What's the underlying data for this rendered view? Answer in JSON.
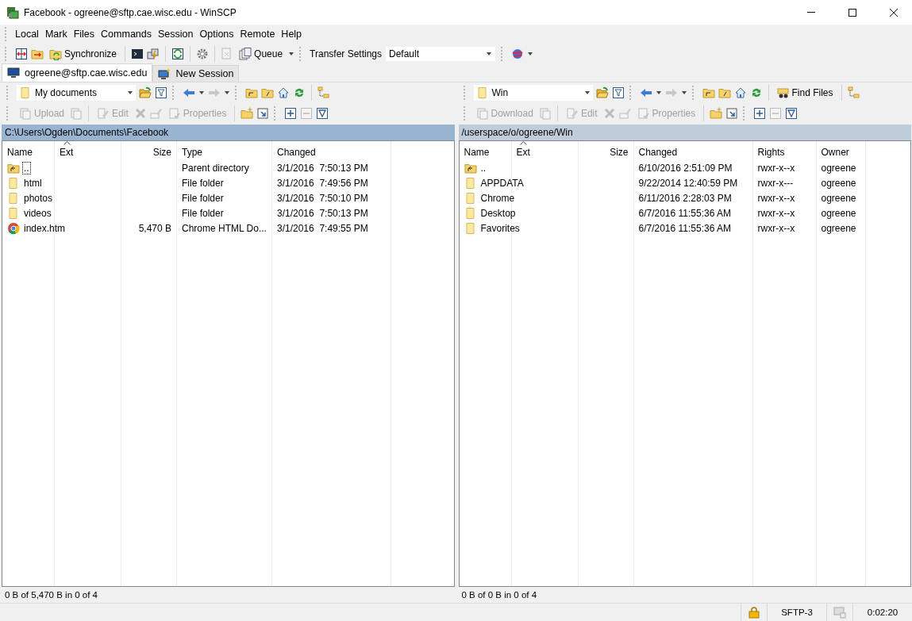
{
  "window": {
    "title": "Facebook - ogreene@sftp.cae.wisc.edu - WinSCP"
  },
  "menu": [
    "Local",
    "Mark",
    "Files",
    "Commands",
    "Session",
    "Options",
    "Remote",
    "Help"
  ],
  "toolbar": {
    "synchronize": "Synchronize",
    "queue": "Queue",
    "transfer_settings_label": "Transfer Settings",
    "transfer_settings_value": "Default"
  },
  "session_tabs": [
    {
      "label": "ogreene@sftp.cae.wisc.edu",
      "selected": true
    },
    {
      "label": "New Session",
      "selected": false
    }
  ],
  "panels": [
    {
      "location": "My documents",
      "active": true,
      "actions": [
        {
          "label": "Upload",
          "disabled": true
        },
        {
          "label": "Edit",
          "disabled": true
        },
        {
          "label": "Properties",
          "disabled": true
        }
      ],
      "path": "C:\\Users\\Ogden\\Documents\\Facebook",
      "columns": [
        {
          "label": "Name",
          "sorted": false
        },
        {
          "label": "Ext",
          "sorted": true
        },
        {
          "label": "Size",
          "sorted": false
        },
        {
          "label": "Type",
          "sorted": false
        },
        {
          "label": "Changed",
          "sorted": false
        }
      ],
      "rows": [
        {
          "kind": "parent",
          "focused": true,
          "cells": [
            "..",
            null,
            null,
            "Parent directory",
            "3/1/2016  7:50:13 PM"
          ]
        },
        {
          "kind": "folder",
          "focused": false,
          "cells": [
            "html",
            null,
            null,
            "File folder",
            "3/1/2016  7:49:56 PM"
          ]
        },
        {
          "kind": "folder",
          "focused": false,
          "cells": [
            "photos",
            null,
            null,
            "File folder",
            "3/1/2016  7:50:10 PM"
          ]
        },
        {
          "kind": "folder",
          "focused": false,
          "cells": [
            "videos",
            null,
            null,
            "File folder",
            "3/1/2016  7:50:13 PM"
          ]
        },
        {
          "kind": "web-file",
          "focused": false,
          "cells": [
            "index.htm",
            null,
            "5,470 B",
            "Chrome HTML Do...",
            "3/1/2016  7:49:55 PM"
          ]
        }
      ],
      "summary": "0 B of 5,470 B in 0 of 4"
    },
    {
      "location": "Win",
      "active": false,
      "find_files": "Find Files",
      "actions": [
        {
          "label": "Download",
          "disabled": true
        },
        {
          "label": "Edit",
          "disabled": true
        },
        {
          "label": "Properties",
          "disabled": true
        }
      ],
      "path": "/userspace/o/ogreene/Win",
      "columns": [
        {
          "label": "Name",
          "sorted": false
        },
        {
          "label": "Ext",
          "sorted": true
        },
        {
          "label": "Size",
          "sorted": false
        },
        {
          "label": "Changed",
          "sorted": false
        },
        {
          "label": "Rights",
          "sorted": false
        },
        {
          "label": "Owner",
          "sorted": false
        }
      ],
      "rows": [
        {
          "kind": "parent",
          "focused": false,
          "cells": [
            "..",
            null,
            null,
            "6/10/2016 2:51:09 PM",
            "rwxr-x--x",
            "ogreene"
          ]
        },
        {
          "kind": "folder",
          "focused": false,
          "cells": [
            "APPDATA",
            null,
            null,
            "9/22/2014 12:40:59 PM",
            "rwxr-x---",
            "ogreene"
          ]
        },
        {
          "kind": "folder",
          "focused": false,
          "cells": [
            "Chrome",
            null,
            null,
            "6/11/2016 2:28:03 PM",
            "rwxr-x--x",
            "ogreene"
          ]
        },
        {
          "kind": "folder",
          "focused": false,
          "cells": [
            "Desktop",
            null,
            null,
            "6/7/2016 11:55:36 AM",
            "rwxr-x--x",
            "ogreene"
          ]
        },
        {
          "kind": "folder",
          "focused": false,
          "cells": [
            "Favorites",
            null,
            null,
            "6/7/2016 11:55:36 AM",
            "rwxr-x--x",
            "ogreene"
          ]
        }
      ],
      "summary": "0 B of 0 B in 0 of 4"
    }
  ],
  "status_bar": {
    "protocol": "SFTP-3",
    "elapsed": "0:02:20"
  }
}
